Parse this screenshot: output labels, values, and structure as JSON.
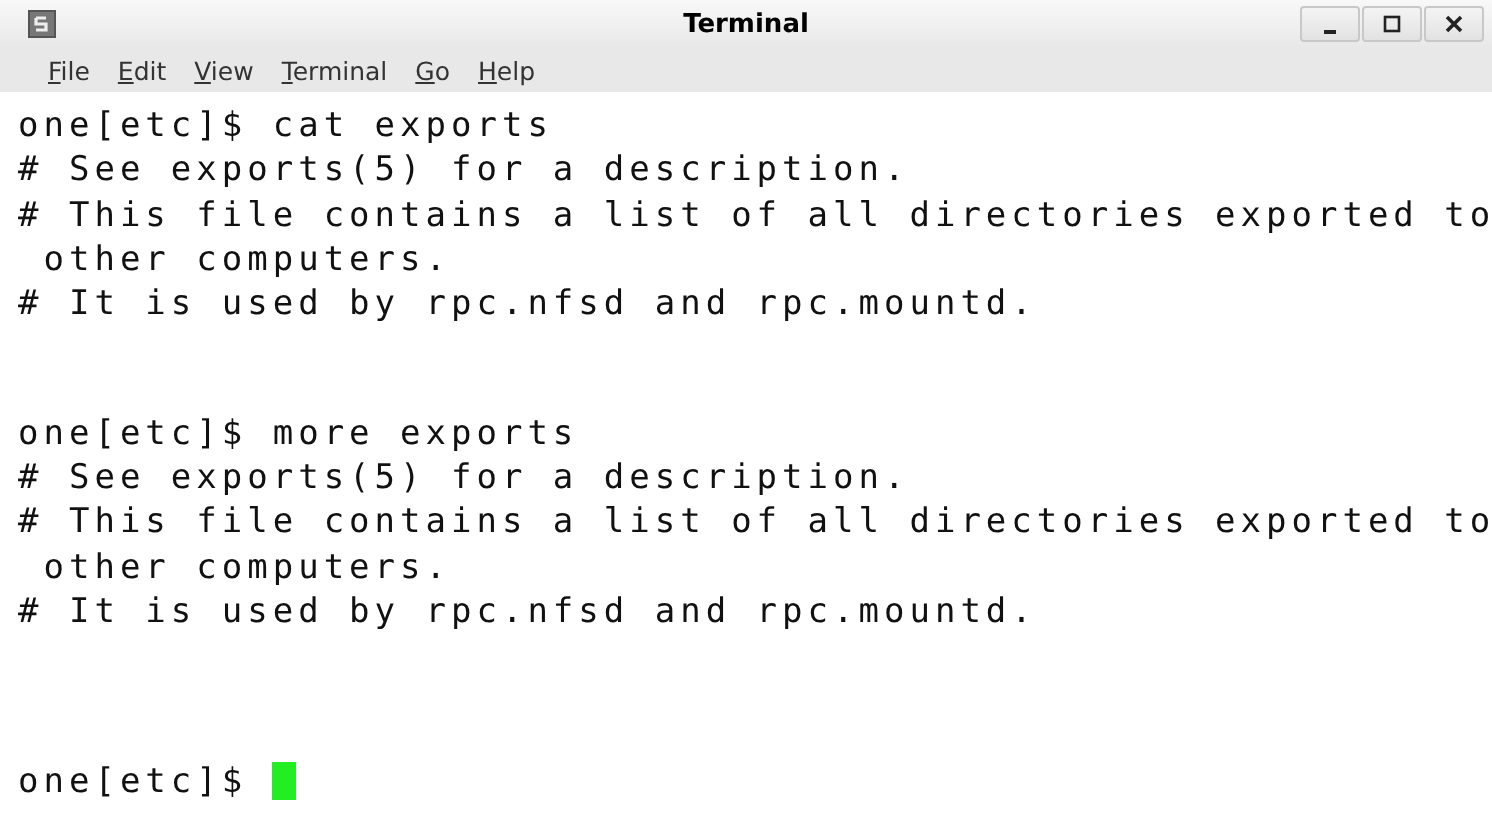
{
  "window": {
    "title": "Terminal"
  },
  "menu": [
    "File",
    "Edit",
    "View",
    "Terminal",
    "Go",
    "Help"
  ],
  "blocks": [
    {
      "lines": [
        "one[etc]$ cat exports",
        "# See exports(5) for a description.",
        "# This file contains a list of all directories exported to",
        " other computers.",
        "# It is used by rpc.nfsd and rpc.mountd."
      ]
    },
    {
      "lines": [
        "one[etc]$ more exports",
        "# See exports(5) for a description.",
        "# This file contains a list of all directories exported to",
        " other computers.",
        "# It is used by rpc.nfsd and rpc.mountd."
      ]
    }
  ],
  "prompt": "one[etc]$ "
}
